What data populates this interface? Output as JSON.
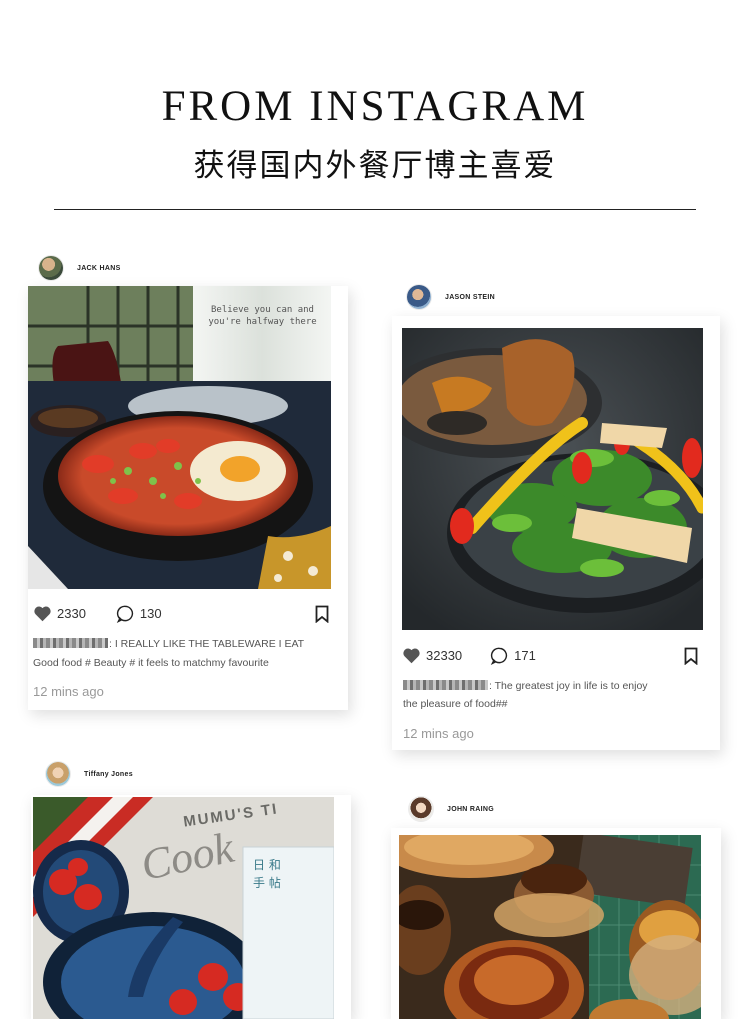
{
  "header": {
    "title": "FROM INSTAGRAM",
    "subtitle": "获得国内外餐厅博主喜爱"
  },
  "posts": [
    {
      "username": "JACK HANS",
      "photo_text": "Believe you can and you're halfway there",
      "likes": "2330",
      "comments": "130",
      "caption_line1": ": I REALLY LIKE THE TABLEWARE I EAT",
      "caption_line2": "Good food # Beauty #   it feels to matchmy favourite",
      "time": "12 mins ago"
    },
    {
      "username": "JASON STEIN",
      "likes": "32330",
      "comments": "171",
      "caption_line1": ": The greatest joy in life is to enjoy",
      "caption_line2": "the pleasure of food##",
      "time": "12 mins ago"
    },
    {
      "username": "Tiffany Jones",
      "photo_text": "MUMU'S TI"
    },
    {
      "username": "JOHN RAING"
    }
  ],
  "icons": [
    "heart-icon",
    "comment-icon",
    "bookmark-icon"
  ],
  "colors": {
    "text": "#222222",
    "muted": "#999999",
    "rule": "#222222"
  }
}
